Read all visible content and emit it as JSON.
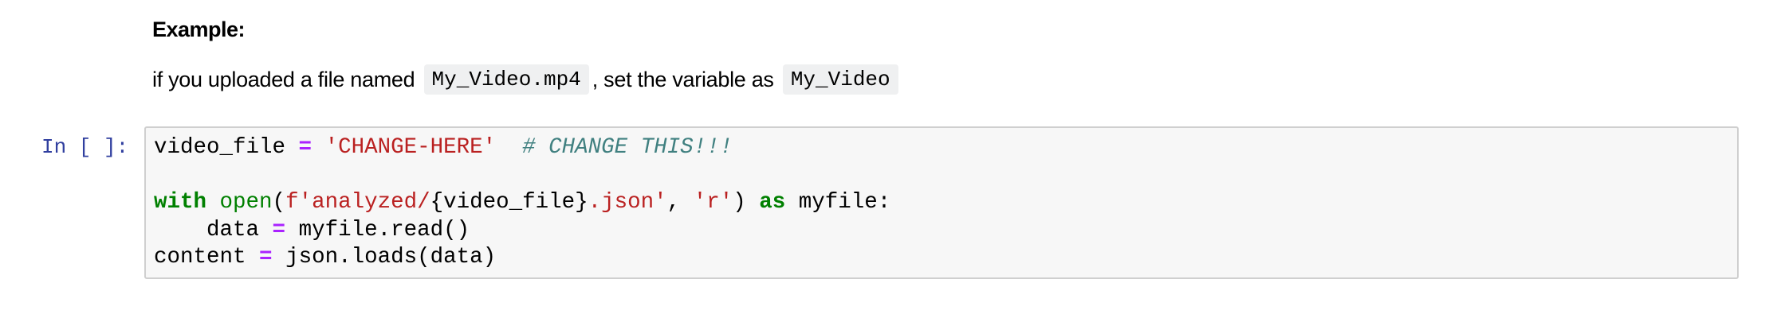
{
  "markdown": {
    "heading": "Example:",
    "para_before": "if you uploaded a file named ",
    "code_filename": "My_Video.mp4",
    "para_middle": ", set the variable as ",
    "code_variable": "My_Video"
  },
  "cell": {
    "prompt": "In [ ]:",
    "line1": {
      "var": "video_file",
      "op": "=",
      "str": "'CHANGE-HERE'",
      "comment": "# CHANGE THIS!!!"
    },
    "line2": {
      "kw_with": "with",
      "fn_open": "open",
      "fstr_start": "f'analyzed/",
      "interp": "{video_file}",
      "fstr_end": ".json'",
      "comma": ", ",
      "mode": "'r'",
      "close": ")",
      "kw_as": "as",
      "target": "myfile:",
      "paren": "("
    },
    "line3": {
      "indent": "    ",
      "var": "data",
      "op": "=",
      "call": "myfile.read()"
    },
    "line4": {
      "var": "content",
      "op": "=",
      "call": "json.loads(data)"
    }
  }
}
